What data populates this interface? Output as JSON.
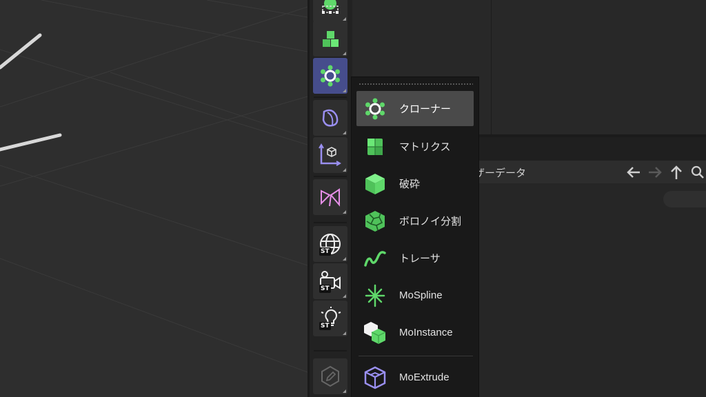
{
  "toolbar": {
    "buttons": [
      {
        "icon": "generator-icon"
      },
      {
        "icon": "cubes-icon"
      },
      {
        "icon": "cloner-icon",
        "active": true
      },
      {
        "icon": "deformer-icon"
      },
      {
        "icon": "coordinate-icon"
      },
      {
        "icon": "bend-icon"
      },
      {
        "icon": "sky-icon",
        "badge": "ST"
      },
      {
        "icon": "camera-icon",
        "badge": "ST"
      },
      {
        "icon": "light-icon",
        "badge": "ST"
      },
      {
        "icon": "edit-icon"
      }
    ]
  },
  "menu": {
    "items": [
      {
        "label": "クローナー",
        "icon": "cloner-icon",
        "highlighted": true
      },
      {
        "label": "マトリクス",
        "icon": "matrix-icon"
      },
      {
        "label": "破砕",
        "icon": "fracture-icon"
      },
      {
        "label": "ボロノイ分割",
        "icon": "voronoi-icon"
      },
      {
        "label": "トレーサ",
        "icon": "tracer-icon"
      },
      {
        "label": "MoSpline",
        "icon": "mospline-icon"
      },
      {
        "label": "MoInstance",
        "icon": "moinstance-icon"
      },
      {
        "label": "MoExtrude",
        "icon": "moextrude-icon"
      }
    ]
  },
  "attributes": {
    "title": "ザーデータ"
  },
  "colors": {
    "accent_green": "#5fd86a",
    "accent_purple": "#9a8ff0",
    "active_button": "#464d8c",
    "highlight": "#4a4a4a"
  }
}
